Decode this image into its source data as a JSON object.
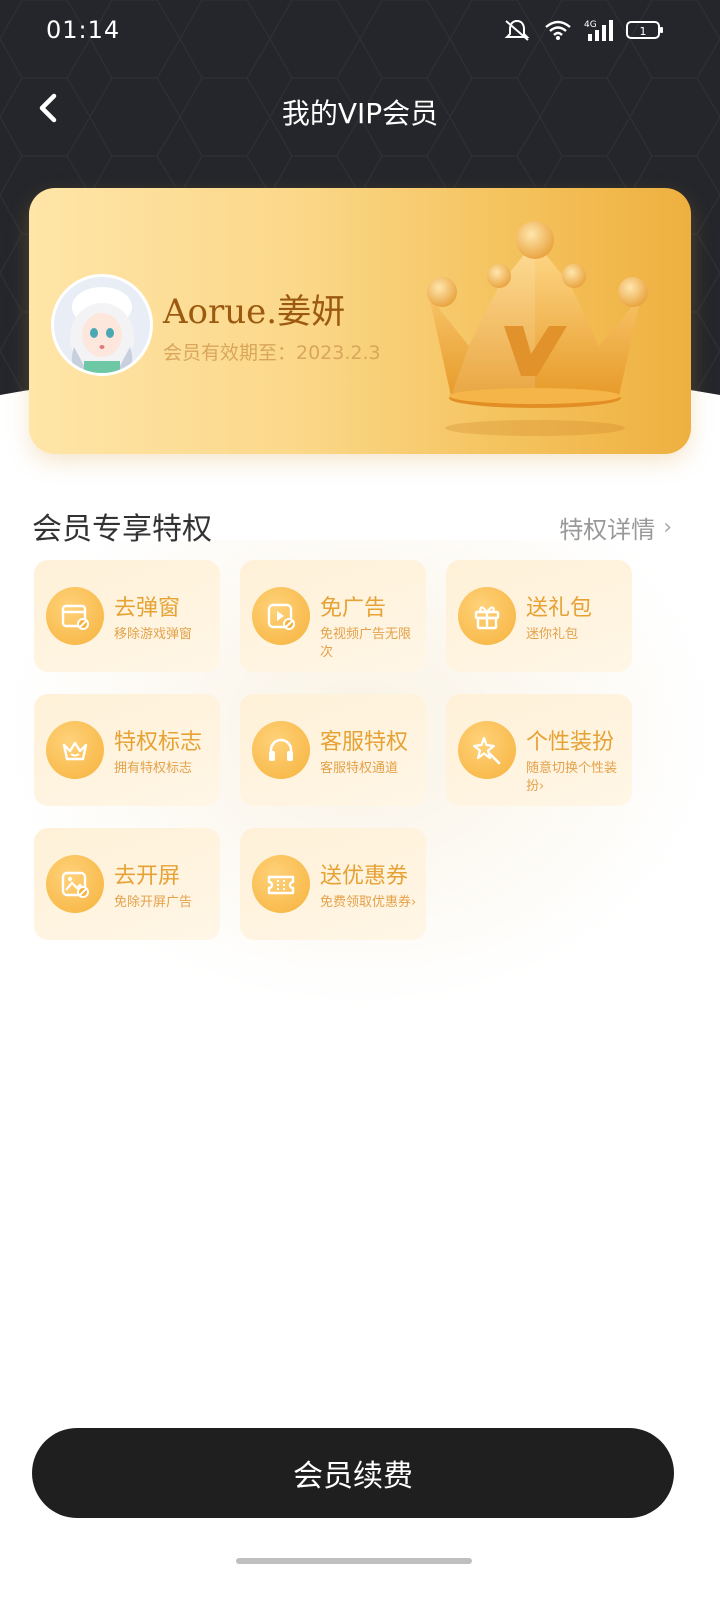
{
  "status_bar": {
    "time": "01:14",
    "network": "4G",
    "battery": "1"
  },
  "nav": {
    "title": "我的VIP会员"
  },
  "vip_card": {
    "username": "Aorue.姜妍",
    "expire_text": "会员有效期至：2023.2.3"
  },
  "privileges": {
    "title": "会员专享特权",
    "more_label": "特权详情",
    "items": [
      {
        "name": "去弹窗",
        "desc": "移除游戏弹窗",
        "icon": "popup-icon"
      },
      {
        "name": "免广告",
        "desc": "免视频广告无限次",
        "icon": "ad-free-icon"
      },
      {
        "name": "送礼包",
        "desc": "迷你礼包",
        "icon": "gift-icon"
      },
      {
        "name": "特权标志",
        "desc": "拥有特权标志",
        "icon": "crown-badge-icon"
      },
      {
        "name": "客服特权",
        "desc": "客服特权通道",
        "icon": "headphones-icon"
      },
      {
        "name": "个性装扮",
        "desc": "随意切换个性装扮›",
        "icon": "magic-star-icon"
      },
      {
        "name": "去开屏",
        "desc": "免除开屏广告",
        "icon": "splash-image-icon"
      },
      {
        "name": "送优惠券",
        "desc": "免费领取优惠券›",
        "icon": "ticket-icon"
      }
    ]
  },
  "renew_button": {
    "label": "会员续费"
  },
  "colors": {
    "header_bg": "#24262b",
    "gold": "#f4c15a",
    "button_bg": "#1f1f1f",
    "tile_text": "#e6a235"
  }
}
